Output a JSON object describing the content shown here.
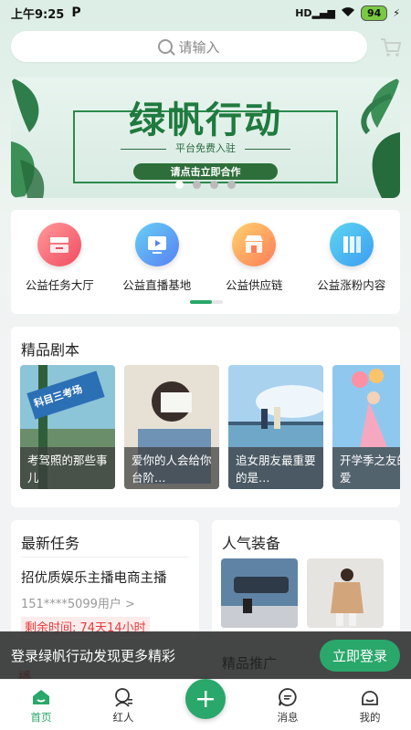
{
  "status": {
    "time": "上午9:25",
    "p_label": "P",
    "net": "HD",
    "battery": "94"
  },
  "search": {
    "placeholder": "请输入"
  },
  "banner": {
    "title": "绿帆行动",
    "subtitle": "平台免费入驻",
    "cta": "请点击立即合作",
    "dots": 4,
    "active_dot": 0
  },
  "services": [
    {
      "label": "公益任务大厅",
      "icon": "task-hall-icon",
      "color_a": "#ff8b8b",
      "color_b": "#f14b62"
    },
    {
      "label": "公益直播基地",
      "icon": "live-base-icon",
      "color_a": "#66d0f5",
      "color_b": "#5880f2"
    },
    {
      "label": "公益供应链",
      "icon": "supply-chain-icon",
      "color_a": "#ffd36b",
      "color_b": "#ff7c5a"
    },
    {
      "label": "公益涨粉内容",
      "icon": "fans-content-icon",
      "color_a": "#5cd6f0",
      "color_b": "#3d9df2"
    }
  ],
  "services_pager_fraction": 0.67,
  "scripts": {
    "title": "精品剧本",
    "items": [
      {
        "caption": "考驾照的那些事儿",
        "caption_display": "考驾照的那\n些事儿",
        "image_text": "科目三考场"
      },
      {
        "caption": "爱你的人会给你台阶…",
        "caption_display": "爱你的人会\n给你台阶…"
      },
      {
        "caption": "追女朋友最重要的是…",
        "caption_display": "追女朋友最\n重要的是…"
      },
      {
        "caption": "开学季之友的恋爱",
        "caption_display": "开学季之\n友的恋爱"
      }
    ]
  },
  "tasks": {
    "title": "最新任务",
    "item_title": "招优质娱乐主播电商主播",
    "user": "151****5099用户 >",
    "remaining": "剩余时间: 74天14小时"
  },
  "equipment": {
    "title": "人气装备"
  },
  "login_bar": {
    "text": "登录绿帆行动发现更多精彩",
    "button": "立即登录",
    "behind_left": "播",
    "behind_right": "精品推广"
  },
  "tabbar": [
    {
      "label": "首页",
      "icon": "home-icon",
      "active": true
    },
    {
      "label": "红人",
      "icon": "influencer-icon",
      "active": false
    },
    {
      "label": "",
      "icon": "plus-icon",
      "active": false
    },
    {
      "label": "消息",
      "icon": "message-icon",
      "active": false
    },
    {
      "label": "我的",
      "icon": "profile-icon",
      "active": false
    }
  ],
  "colors": {
    "brand": "#2aa76a",
    "banner_green": "#1f7a3e",
    "danger": "#e53b3b"
  }
}
